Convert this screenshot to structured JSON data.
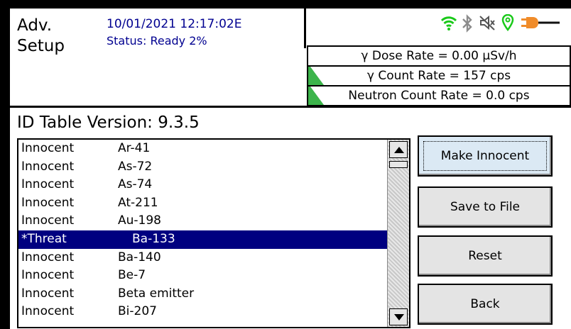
{
  "header": {
    "title_line1": "Adv.",
    "title_line2": "Setup",
    "timestamp": "10/01/2021 12:17:02E",
    "status": "Status: Ready 2%"
  },
  "status_icons": [
    "wifi-icon",
    "bluetooth-icon",
    "mute-icon",
    "location-pin-icon",
    "power-plug-icon"
  ],
  "colors": {
    "accent_text": "#000090",
    "selection": "#000080",
    "indicator": "#3cb44b"
  },
  "rates": {
    "dose": "γ Dose Rate = 0.00  µSv/h",
    "count": "γ Count Rate = 157 cps",
    "neutron": "Neutron Count Rate = 0.0 cps"
  },
  "id_table": {
    "version_label": "ID Table Version: 9.3.5",
    "rows": [
      {
        "type": "Innocent",
        "nuclide": "Ar-41"
      },
      {
        "type": "Innocent",
        "nuclide": "As-72"
      },
      {
        "type": "Innocent",
        "nuclide": "As-74"
      },
      {
        "type": "Innocent",
        "nuclide": "At-211"
      },
      {
        "type": "Innocent",
        "nuclide": "Au-198"
      },
      {
        "type": "*Threat",
        "nuclide": "Ba-133"
      },
      {
        "type": "Innocent",
        "nuclide": "Ba-140"
      },
      {
        "type": "Innocent",
        "nuclide": "Be-7"
      },
      {
        "type": "Innocent",
        "nuclide": "Beta emitter"
      },
      {
        "type": "Innocent",
        "nuclide": "Bi-207"
      }
    ]
  },
  "buttons": {
    "make_innocent": "Make Innocent",
    "save_to_file": "Save to File",
    "reset": "Reset",
    "back": "Back"
  }
}
